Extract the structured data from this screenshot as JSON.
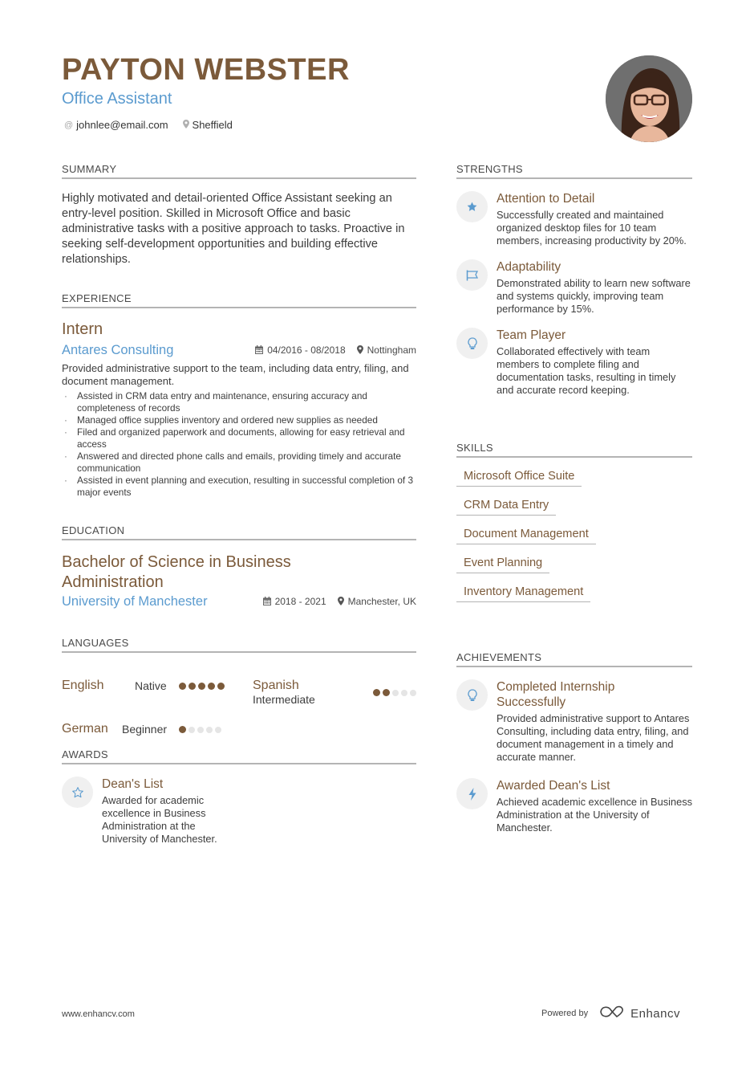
{
  "header": {
    "name": "PAYTON WEBSTER",
    "role": "Office Assistant",
    "email": "johnlee@email.com",
    "email_icon": "at-icon",
    "location": "Sheffield",
    "location_icon": "map-pin-icon",
    "photo": "profile-photo"
  },
  "colors": {
    "accent_brown": "#7b5a3a",
    "accent_blue": "#5b9bcf",
    "divider": "#b4b4b4"
  },
  "summary": {
    "title": "SUMMARY",
    "text": "Highly motivated and detail-oriented Office Assistant seeking an entry-level position. Skilled in Microsoft Office and basic administrative tasks with a positive approach to tasks. Proactive in seeking self-development opportunities and building effective relationships."
  },
  "experience": {
    "title": "EXPERIENCE",
    "jobs": [
      {
        "title": "Intern",
        "company": "Antares Consulting",
        "dates": "04/2016 - 08/2018",
        "location": "Nottingham",
        "description": "Provided administrative support to the team, including data entry, filing, and document management.",
        "bullets": [
          "Assisted in CRM data entry and maintenance, ensuring accuracy and completeness of records",
          "Managed office supplies inventory and ordered new supplies as needed",
          "Filed and organized paperwork and documents, allowing for easy retrieval and access",
          "Answered and directed phone calls and emails, providing timely and accurate communication",
          "Assisted in event planning and execution, resulting in successful completion of 3 major events"
        ]
      }
    ]
  },
  "education": {
    "title": "EDUCATION",
    "items": [
      {
        "degree": "Bachelor of Science in Business Administration",
        "school": "University of Manchester",
        "dates": "2018 - 2021",
        "location": "Manchester, UK"
      }
    ]
  },
  "languages": {
    "title": "LANGUAGES",
    "items": [
      {
        "name": "English",
        "level": "Native",
        "rating": 5,
        "max": 5
      },
      {
        "name": "Spanish",
        "level": "Intermediate",
        "rating": 2,
        "max": 5
      },
      {
        "name": "German",
        "level": "Beginner",
        "rating": 1,
        "max": 5
      }
    ]
  },
  "awards": {
    "title": "AWARDS",
    "items": [
      {
        "icon": "star-outline-icon",
        "title": "Dean's List",
        "description": "Awarded for academic excellence in Business Administration at the University of Manchester."
      }
    ]
  },
  "strengths": {
    "title": "STRENGTHS",
    "items": [
      {
        "icon": "star-icon",
        "title": "Attention to Detail",
        "description": "Successfully created and maintained organized desktop files for 10 team members, increasing productivity by 20%."
      },
      {
        "icon": "flag-icon",
        "title": "Adaptability",
        "description": "Demonstrated ability to learn new software and systems quickly, improving team performance by 15%."
      },
      {
        "icon": "lightbulb-icon",
        "title": "Team Player",
        "description": "Collaborated effectively with team members to complete filing and documentation tasks, resulting in timely and accurate record keeping."
      }
    ]
  },
  "skills": {
    "title": "SKILLS",
    "items": [
      "Microsoft Office Suite",
      "CRM Data Entry",
      "Document Management",
      "Event Planning",
      "Inventory Management"
    ]
  },
  "achievements": {
    "title": "ACHIEVEMENTS",
    "items": [
      {
        "icon": "lightbulb-icon",
        "title": "Completed Internship Successfully",
        "description": "Provided administrative support to Antares Consulting, including data entry, filing, and document management in a timely and accurate manner."
      },
      {
        "icon": "lightning-icon",
        "title": "Awarded Dean's List",
        "description": "Achieved academic excellence in Business Administration at the University of Manchester."
      }
    ]
  },
  "footer": {
    "website": "www.enhancv.com",
    "powered_by": "Powered by",
    "brand": "Enhancv"
  }
}
